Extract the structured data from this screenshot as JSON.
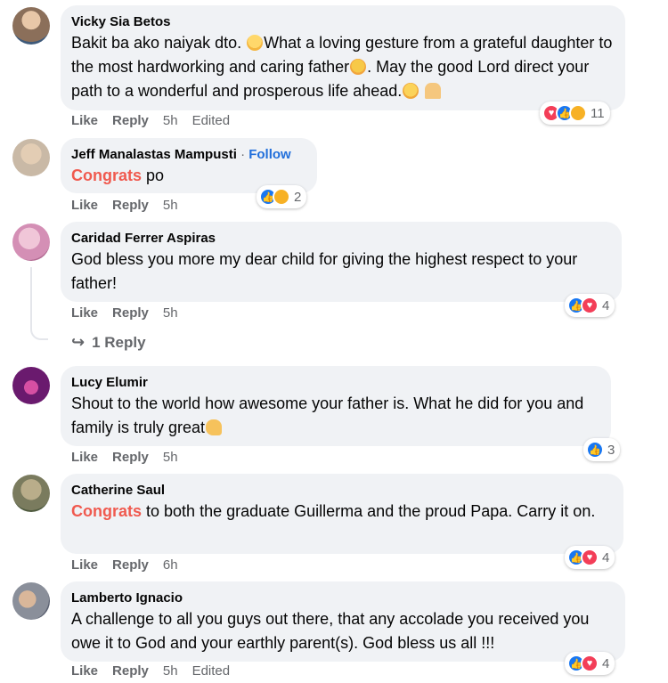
{
  "comments": [
    {
      "author": "Vicky Sia Betos",
      "text_1": "Bakit ba ako naiyak dto. ",
      "text_2": "What a loving gesture from a grateful daughter to the most hardworking and caring father",
      "text_3": ". May the good Lord direct your path to a wonderful and prosperous life ahead.",
      "like": "Like",
      "reply": "Reply",
      "time": "5h",
      "edited": "Edited",
      "reaction_count": "11",
      "avatar_color": "#8b6f5a"
    },
    {
      "author": "Jeff Manalastas Mampusti",
      "separator": "·",
      "follow": "Follow",
      "highlight": "Congrats",
      "text": " po",
      "like": "Like",
      "reply": "Reply",
      "time": "5h",
      "reaction_count": "2",
      "avatar_color": "#c9b9a6"
    },
    {
      "author": "Caridad Ferrer Aspiras",
      "text": "God bless you more my dear child for giving the highest respect to your father!",
      "like": "Like",
      "reply": "Reply",
      "time": "5h",
      "reaction_count": "4",
      "replies_link": "1 Reply",
      "avatar_color": "#d48fb5"
    },
    {
      "author": "Lucy Elumir",
      "text": "Shout to the world how awesome your father is. What he did for you and family is truly great",
      "like": "Like",
      "reply": "Reply",
      "time": "5h",
      "reaction_count": "3",
      "avatar_color": "#6a1a6e"
    },
    {
      "author": "Catherine Saul",
      "highlight": "Congrats",
      "text": " to both the graduate Guillerma and the proud Papa. Carry it on.",
      "like": "Like",
      "reply": "Reply",
      "time": "6h",
      "reaction_count": "4",
      "avatar_color": "#7a7b5e"
    },
    {
      "author": "Lamberto Ignacio",
      "text": "A challenge to all you guys out there, that any accolade you received you owe it to God and your earthly parent(s). God bless us all !!!",
      "like": "Like",
      "reply": "Reply",
      "time": "5h",
      "edited": "Edited",
      "reaction_count": "4",
      "avatar_color": "#8a8f9a"
    }
  ],
  "colors": {
    "bubble": "#f0f2f5",
    "link_blue": "#216fdb",
    "congrats": "#f05a4f",
    "meta_gray": "#65676b",
    "like_blue": "#1877f2",
    "love_red": "#f33e58"
  }
}
